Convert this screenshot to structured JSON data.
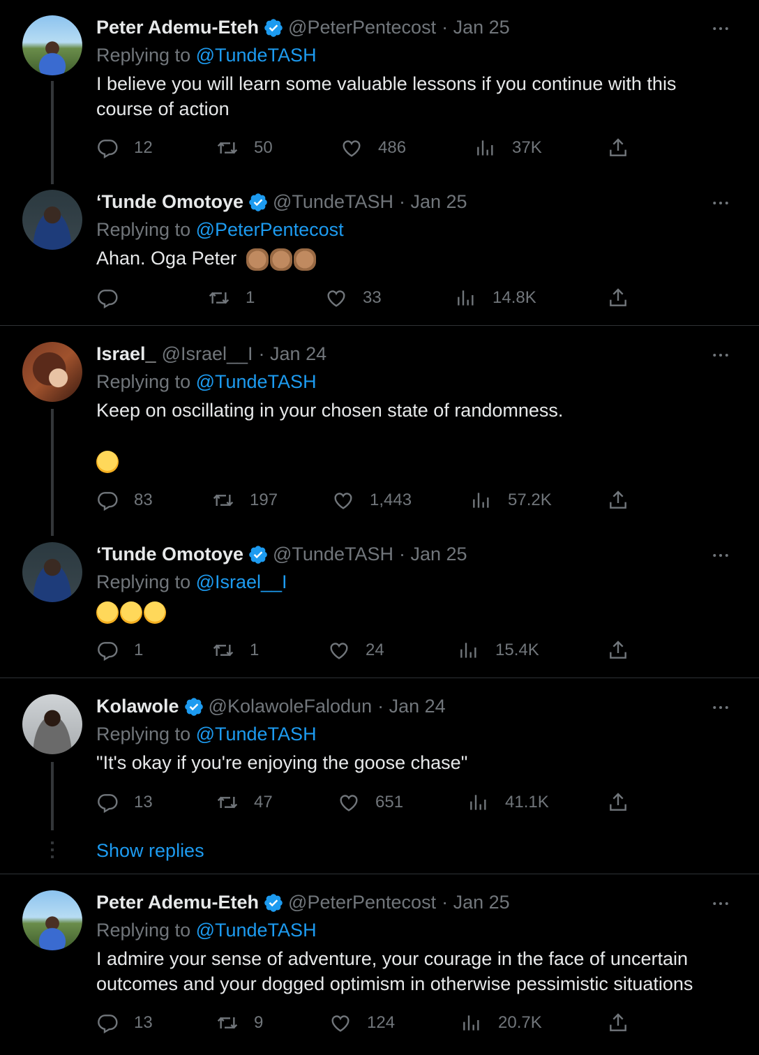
{
  "tweets": [
    {
      "name": "Peter Ademu-Eteh",
      "handle": "@PeterPentecost",
      "date": "· Jan 25",
      "replying_prefix": "Replying to ",
      "replying_to": "@TundeTASH",
      "text": "I believe you will learn some valuable lessons if you continue with this course of action",
      "replies": "12",
      "retweets": "50",
      "likes": "486",
      "views": "37K"
    },
    {
      "name": "‘Tunde Omotoye",
      "handle": "@TundeTASH",
      "date": "· Jan 25",
      "replying_prefix": "Replying to ",
      "replying_to": "@PeterPentecost",
      "text": "Ahan. Oga Peter",
      "emojis": [
        "clapping-hands",
        "clapping-hands",
        "clapping-hands"
      ],
      "replies": "",
      "retweets": "1",
      "likes": "33",
      "views": "14.8K"
    },
    {
      "name": "Israel_",
      "handle": "@Israel__I",
      "date": "· Jan 24",
      "replying_prefix": "Replying to ",
      "replying_to": "@TundeTASH",
      "text": "Keep on oscillating in your chosen state of randomness.",
      "emojis": [
        "rolling-on-floor-laughing"
      ],
      "replies": "83",
      "retweets": "197",
      "likes": "1,443",
      "views": "57.2K"
    },
    {
      "name": "‘Tunde Omotoye",
      "handle": "@TundeTASH",
      "date": "· Jan 25",
      "replying_prefix": "Replying to ",
      "replying_to": "@Israel__I",
      "emojis": [
        "tears-of-joy",
        "tears-of-joy",
        "rolling-on-floor-laughing"
      ],
      "replies": "1",
      "retweets": "1",
      "likes": "24",
      "views": "15.4K"
    },
    {
      "name": "Kolawole",
      "handle": "@KolawoleFalodun",
      "date": "· Jan 24",
      "replying_prefix": "Replying to ",
      "replying_to": "@TundeTASH",
      "text": "\"It's okay if you're enjoying the goose chase\"",
      "replies": "13",
      "retweets": "47",
      "likes": "651",
      "views": "41.1K"
    },
    {
      "name": "Peter Ademu-Eteh",
      "handle": "@PeterPentecost",
      "date": "· Jan 25",
      "replying_prefix": "Replying to ",
      "replying_to": "@TundeTASH",
      "text_lines": [
        "I admire your sense of adventure, your courage in the face of uncertain",
        "outcomes and your dogged optimism in otherwise pessimistic situations"
      ],
      "replies": "13",
      "retweets": "9",
      "likes": "124",
      "views": "20.7K"
    }
  ],
  "show_replies": "Show replies",
  "colors": {
    "background": "#000000",
    "text": "#e7e9ea",
    "muted": "#71767b",
    "link": "#1d9bf0",
    "border": "#2f3336"
  },
  "icons": [
    "verified-badge-icon",
    "more-icon",
    "reply-icon",
    "retweet-icon",
    "like-icon",
    "views-icon",
    "share-icon"
  ]
}
